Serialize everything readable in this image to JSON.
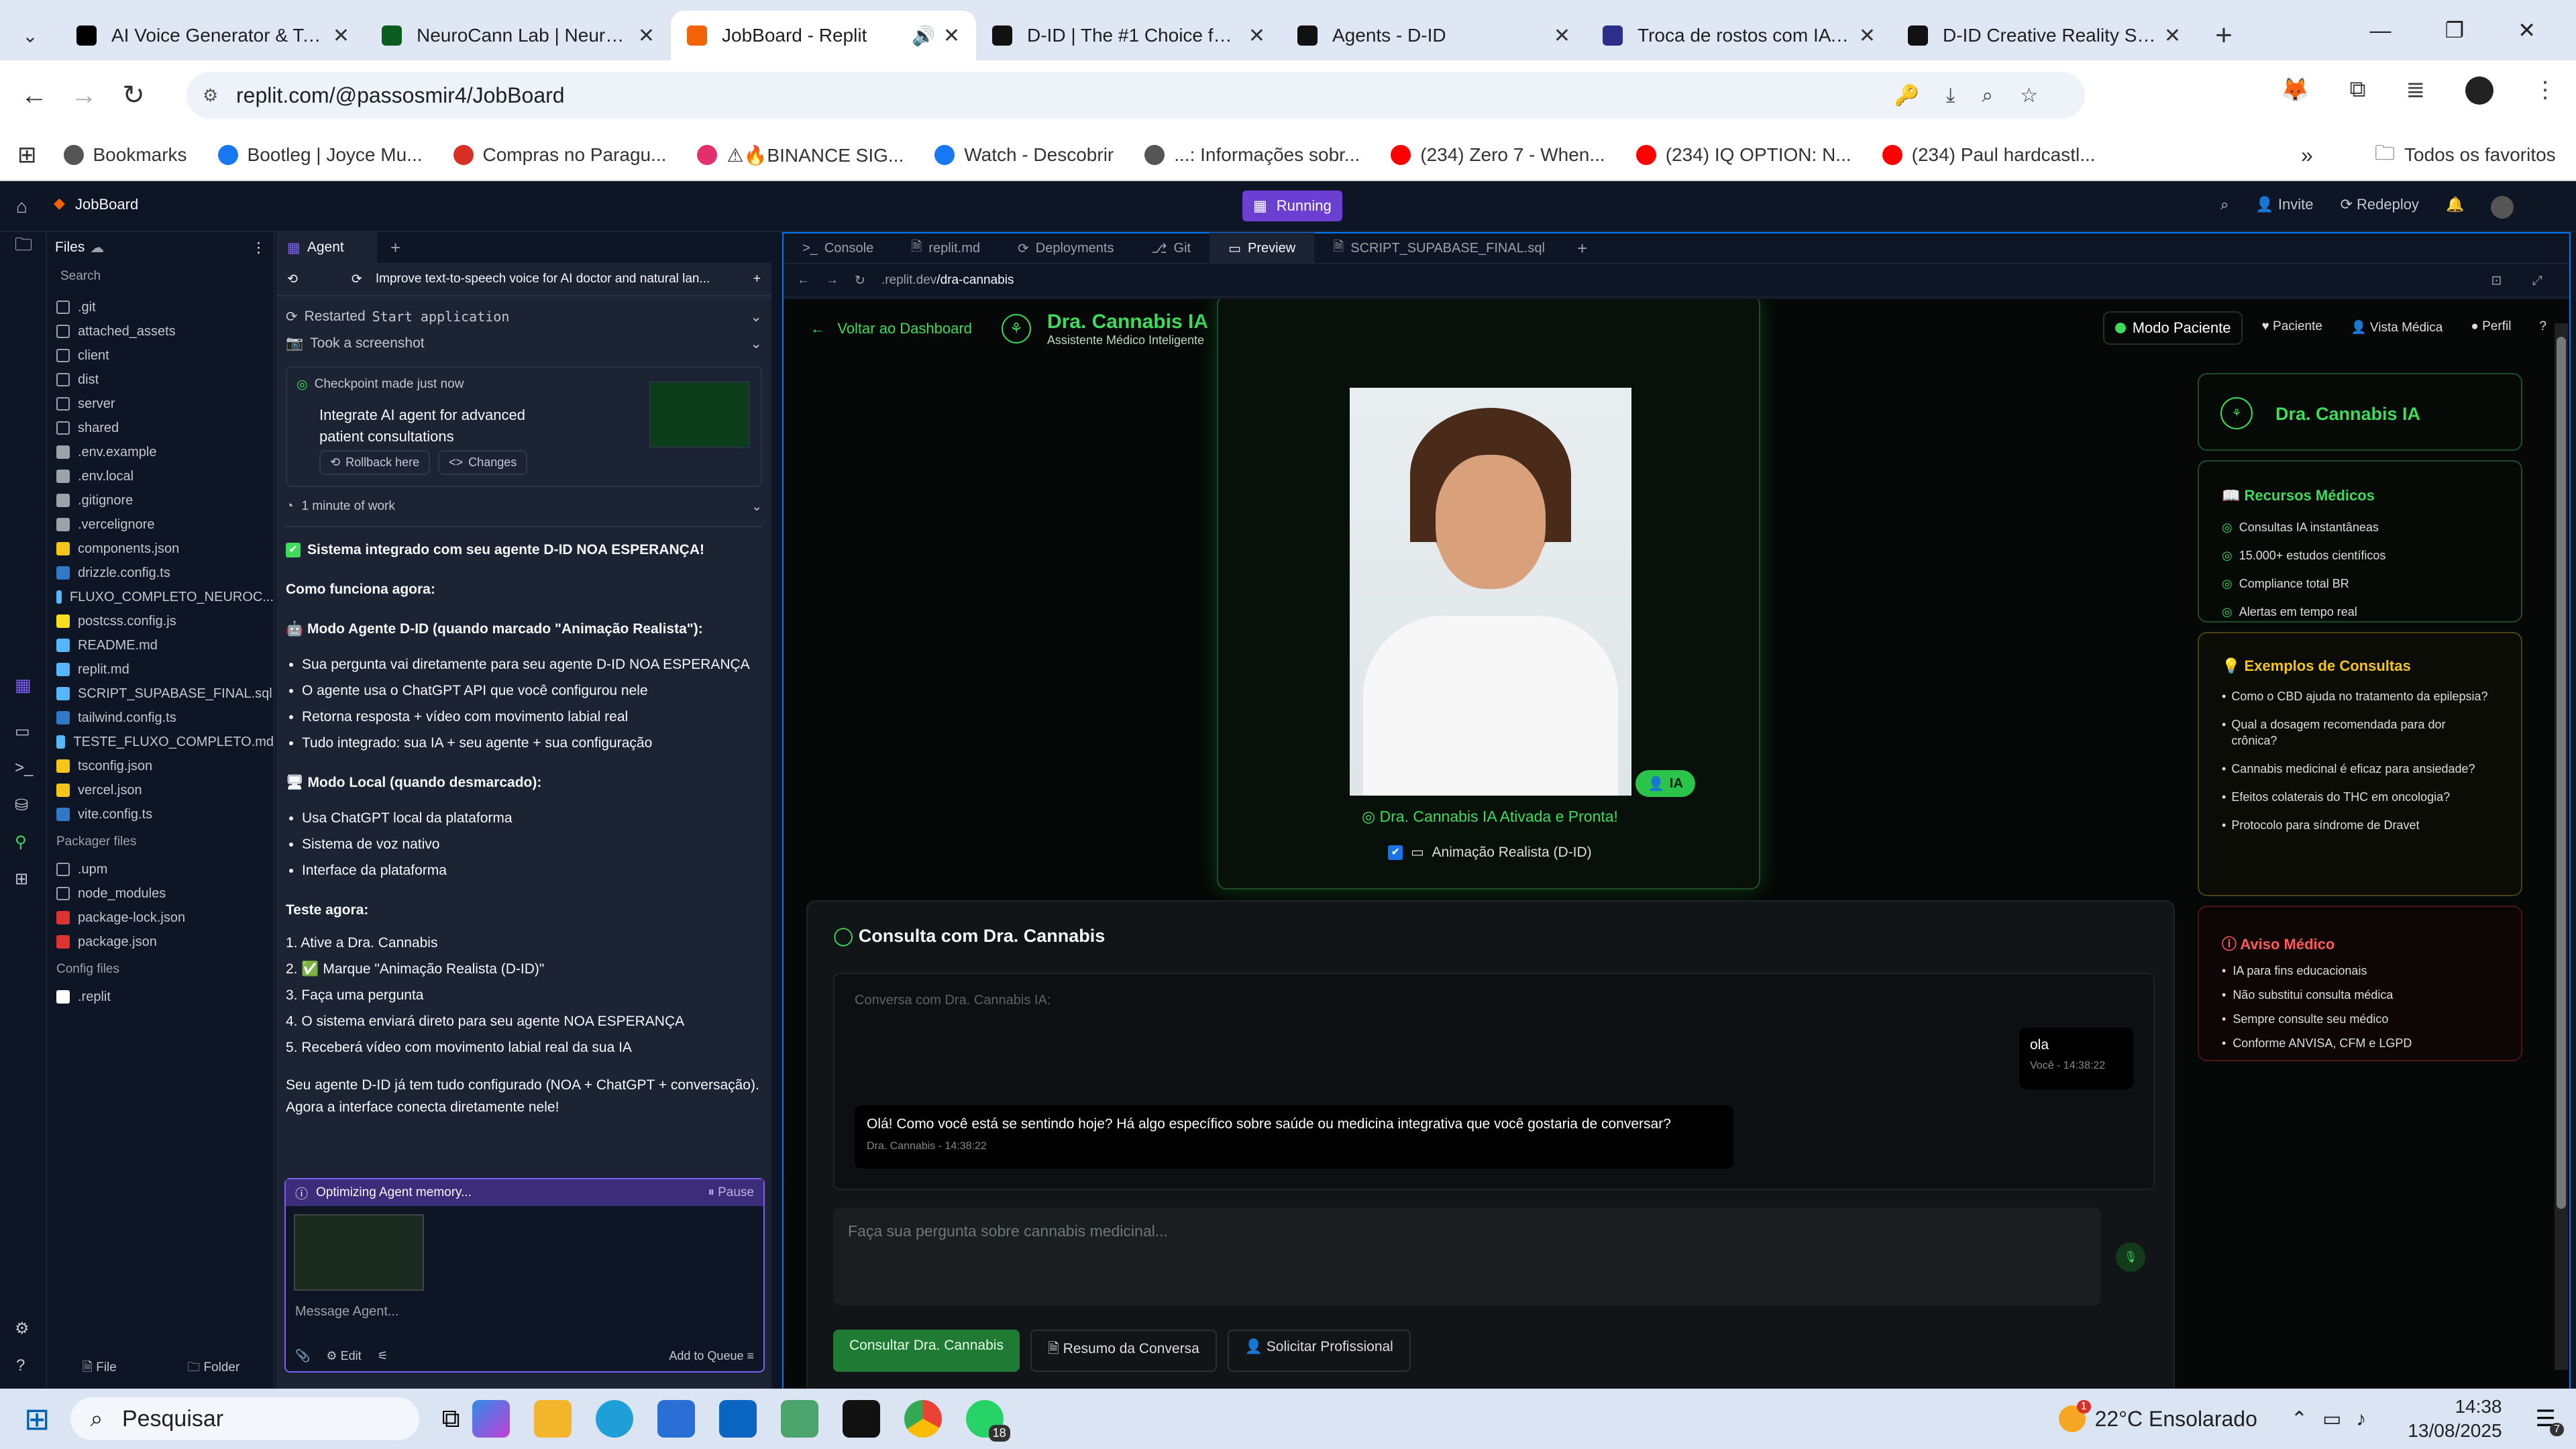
{
  "browser": {
    "tabs": [
      {
        "title": "AI Voice Generator & Text",
        "color": "#000"
      },
      {
        "title": "NeuroCann Lab | NeuroCa",
        "color": "#0b5d1e"
      },
      {
        "title": "JobBoard - Replit",
        "color": "#f26207",
        "active": true
      },
      {
        "title": "D-ID | The #1 Choice for AI",
        "color": "#111"
      },
      {
        "title": "Agents - D-ID",
        "color": "#111"
      },
      {
        "title": "Troca de rostos com IA pa",
        "color": "#2b2f8a"
      },
      {
        "title": "D-ID Creative Reality Stud",
        "color": "#111"
      }
    ],
    "url": "replit.com/@passosmir4/JobBoard",
    "bookmarks": [
      {
        "label": "Bookmarks",
        "color": "#555"
      },
      {
        "label": "Bootleg | Joyce Mu...",
        "color": "#1877f2"
      },
      {
        "label": "Compras no Paragu...",
        "color": "#d93025"
      },
      {
        "label": "⚠🔥BINANCE SIG...",
        "color": "#e1306c"
      },
      {
        "label": "Watch - Descobrir",
        "color": "#1877f2"
      },
      {
        "label": "...: Informações sobr...",
        "color": "#555"
      },
      {
        "label": "(234) Zero 7 - When...",
        "color": "#ff0000"
      },
      {
        "label": "(234) IQ OPTION: N...",
        "color": "#ff0000"
      },
      {
        "label": "(234) Paul hardcastl...",
        "color": "#ff0000"
      }
    ],
    "bookmarks_all": "Todos os favoritos"
  },
  "replit": {
    "project": "JobBoard",
    "status": "Running",
    "invite": "Invite",
    "redeploy": "Redeploy",
    "files_title": "Files",
    "search_placeholder": "Search",
    "files": [
      {
        "name": ".git",
        "type": "folder"
      },
      {
        "name": "attached_assets",
        "type": "folder"
      },
      {
        "name": "client",
        "type": "folder"
      },
      {
        "name": "dist",
        "type": "folder"
      },
      {
        "name": "server",
        "type": "folder"
      },
      {
        "name": "shared",
        "type": "folder"
      },
      {
        "name": ".env.example",
        "type": "file"
      },
      {
        "name": ".env.local",
        "type": "file"
      },
      {
        "name": ".gitignore",
        "type": "file"
      },
      {
        "name": ".vercelignore",
        "type": "file"
      },
      {
        "name": "components.json",
        "type": "json"
      },
      {
        "name": "drizzle.config.ts",
        "type": "ts"
      },
      {
        "name": "FLUXO_COMPLETO_NEUROC...",
        "type": "md"
      },
      {
        "name": "postcss.config.js",
        "type": "js"
      },
      {
        "name": "README.md",
        "type": "md"
      },
      {
        "name": "replit.md",
        "type": "md"
      },
      {
        "name": "SCRIPT_SUPABASE_FINAL.sql",
        "type": "sql"
      },
      {
        "name": "tailwind.config.ts",
        "type": "ts"
      },
      {
        "name": "TESTE_FLUXO_COMPLETO.md",
        "type": "md"
      },
      {
        "name": "tsconfig.json",
        "type": "json"
      },
      {
        "name": "vercel.json",
        "type": "json"
      },
      {
        "name": "vite.config.ts",
        "type": "ts"
      }
    ],
    "packager_title": "Packager files",
    "packager": [
      {
        "name": ".upm",
        "type": "folder"
      },
      {
        "name": "node_modules",
        "type": "folder"
      },
      {
        "name": "package-lock.json",
        "type": "pkg"
      },
      {
        "name": "package.json",
        "type": "pkg"
      }
    ],
    "config_title": "Config files",
    "config": [
      {
        "name": ".replit",
        "type": "replit"
      }
    ],
    "file_btn": "File",
    "folder_btn": "Folder"
  },
  "agent": {
    "tab": "Agent",
    "thread_title": "Improve text-to-speech voice for AI doctor and natural lan...",
    "restarted": "Restarted",
    "restarted_code": "Start application",
    "screenshot": "Took a screenshot",
    "checkpoint": "Checkpoint made just now",
    "checkpoint_msg": "Integrate AI agent for advanced patient consultations",
    "rollback": "Rollback here",
    "changes": "Changes",
    "work": "1 minute of work",
    "heading": "Sistema integrado com seu agente D-ID NOA ESPERANÇA!",
    "how": "Como funciona agora:",
    "mode1": "Modo Agente D-ID (quando marcado \"Animação Realista\"):",
    "mode1_items": [
      "Sua pergunta vai diretamente para seu agente D-ID NOA ESPERANÇA",
      "O agente usa o ChatGPT API que você configurou nele",
      "Retorna resposta + vídeo com movimento labial real",
      "Tudo integrado: sua IA + seu agente + sua configuração"
    ],
    "mode2": "Modo Local (quando desmarcado):",
    "mode2_items": [
      "Usa ChatGPT local da plataforma",
      "Sistema de voz nativo",
      "Interface da plataforma"
    ],
    "test": "Teste agora:",
    "test_items": [
      "1. Ative a Dra. Cannabis",
      "2. ✅ Marque \"Animação Realista (D-ID)\"",
      "3. Faça uma pergunta",
      "4. O sistema enviará direto para seu agente NOA ESPERANÇA",
      "5. Receberá vídeo com movimento labial real da sua IA"
    ],
    "closing": "Seu agente D-ID já tem tudo configurado (NOA + ChatGPT + conversação). Agora a interface conecta diretamente nele!",
    "optimizing": "Optimizing Agent memory...",
    "pause": "Pause",
    "message_placeholder": "Message Agent...",
    "edit": "Edit",
    "add_queue": "Add to Queue"
  },
  "preview": {
    "tabs": [
      "Console",
      "replit.md",
      "Deployments",
      "Git",
      "Preview",
      "SCRIPT_SUPABASE_FINAL.sql"
    ],
    "url_prefix": ".replit.dev",
    "url_path": "/dra-cannabis"
  },
  "site": {
    "back": "Voltar ao Dashboard",
    "title": "Dra. Cannabis IA",
    "subtitle": "Assistente Médico Inteligente",
    "mode": "Modo Paciente",
    "nav": [
      "Paciente",
      "Vista Médica",
      "Perfil"
    ],
    "ia_badge": "IA",
    "status": "Dra. Cannabis IA Ativada e Pronta!",
    "realistic": "Animação Realista (D-ID)",
    "side_title": "Dra. Cannabis IA",
    "resources_title": "Recursos Médicos",
    "resources": [
      "Consultas IA instantâneas",
      "15.000+ estudos científicos",
      "Compliance total BR",
      "Alertas em tempo real"
    ],
    "examples_title": "Exemplos de Consultas",
    "examples": [
      "Como o CBD ajuda no tratamento da epilepsia?",
      "Qual a dosagem recomendada para dor crônica?",
      "Cannabis medicinal é eficaz para ansiedade?",
      "Efeitos colaterais do THC em oncologia?",
      "Protocolo para síndrome de Dravet"
    ],
    "warning_title": "Aviso Médico",
    "warnings": [
      "IA para fins educacionais",
      "Não substitui consulta médica",
      "Sempre consulte seu médico",
      "Conforme ANVISA, CFM e LGPD"
    ],
    "chat_title": "Consulta com Dra. Cannabis",
    "chat_label": "Conversa com Dra. Cannabis IA:",
    "user_msg": "ola",
    "user_meta": "Você - 14:38:22",
    "bot_msg": "Olá! Como você está se sentindo hoje? Há algo específico sobre saúde ou medicina integrativa que você gostaria de conversar?",
    "bot_meta": "Dra. Cannabis - 14:38:22",
    "input_placeholder": "Faça sua pergunta sobre cannabis medicinal...",
    "btn_consult": "Consultar Dra. Cannabis",
    "btn_summary": "Resumo da Conversa",
    "btn_pro": "Solicitar Profissional"
  },
  "taskbar": {
    "search": "Pesquisar",
    "weather": "22°C  Ensolarado",
    "time": "14:38",
    "date": "13/08/2025",
    "whatsapp_badge": "18",
    "notif_badge": "7",
    "weather_badge": "1"
  }
}
